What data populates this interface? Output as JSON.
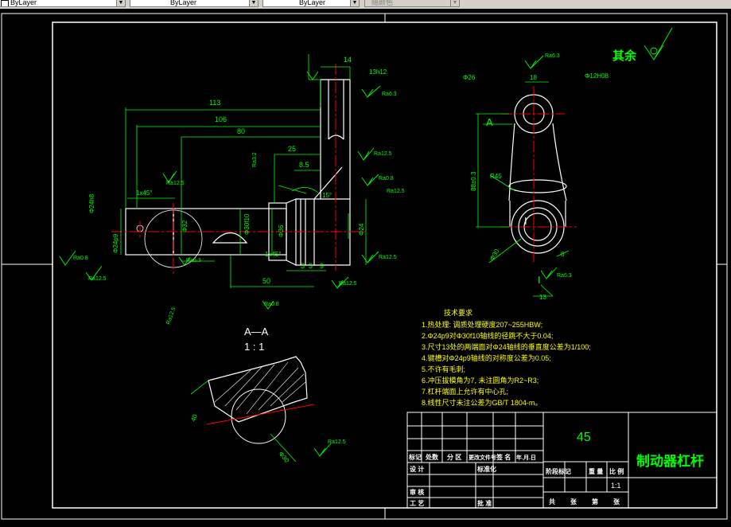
{
  "toolbar": {
    "layer_combo": "ByLayer",
    "linetype_combo": "ByLayer",
    "lineweight_combo": "ByLayer",
    "plotstyle_combo": "随颜色"
  },
  "colors": {
    "background": "#000000",
    "outline": "#ffffff",
    "dimension": "#00ff00",
    "centerline": "#ff0000",
    "note_text": "#ffff00"
  },
  "drawing": {
    "roughness_other": "其余",
    "section_label": "A—A",
    "section_scale": "1 : 1",
    "view_marker_a": "A",
    "view_marker_i": "I",
    "dims": {
      "d113": "113",
      "d106": "106",
      "d80": "80",
      "d25": "25",
      "d8_5": "8.5",
      "d14": "14",
      "d13h12": "13h12",
      "d50": "50",
      "d3a": "3",
      "d3b": "3",
      "d9": "9",
      "d1x45a": "1x45°",
      "d1x45b": "1x45°",
      "d15": "15°",
      "d18": "18",
      "d26": "Φ26",
      "d12h08": "Φ12H08",
      "d88": "88±0.3",
      "r45": "R45",
      "d6": "6",
      "d13": "13",
      "d30": "Φ30",
      "phi24a": "Φ24h8",
      "phi24b": "Φ24p9",
      "phi32": "Φ32",
      "phi30f": "Φ30f10",
      "phi36": "Φ36",
      "phi24c": "Φ24",
      "sec40": "40",
      "sec30": "Φ30",
      "ra63a": "Ra6.3",
      "ra63b": "Ra6.3",
      "ra63c": "Ra6.3",
      "ra63d": "Ra6.3",
      "ra125a": "Ra12.5",
      "ra125b": "Ra12.5",
      "ra125c": "Ra12.5",
      "ra125d": "Ra12.5",
      "ra125e": "Ra12.5",
      "ra125f": "Ra12.5",
      "ra125g": "Ra12.5",
      "ra125h": "Ra12.5",
      "ra08a": "Ra0.8",
      "ra08b": "Ra0.8",
      "ra08c": "Ra0.8",
      "ra32": "Ra3.2"
    }
  },
  "tech_notes": {
    "title": "技术要求",
    "lines": [
      "1.热处理: 调质处理硬度207~255HBW;",
      "2.Φ24p9对Φ30f10轴线的径跳不大于0.04;",
      "3.尺寸13处的两端面对Φ24轴线的垂直度公差为1/100;",
      "4.键槽对Φ24p9轴线的对称度公差为0.05;",
      "5.不许有毛刺;",
      "6.冲压拔模角为7, 未注圆角为R2~R3;",
      "7.杠杆端面上允许有中心孔;",
      "8.线性尺寸未注公差为GB/T 1804-m。"
    ]
  },
  "title_block": {
    "material": "45",
    "part_name": "制动器杠杆",
    "scale_value": "1:1",
    "h_marking": "标记",
    "h_count": "处数",
    "h_zone": "分 区",
    "h_docno": "更改文件号",
    "h_sign": "签 名",
    "h_date": "年.月.日",
    "h_design": "设 计",
    "h_std": "标准化",
    "h_stage": "阶段标记",
    "h_weight": "重 量",
    "h_ratio": "比 例",
    "h_review": "审 核",
    "h_process": "工 艺",
    "h_approve": "批 准",
    "h_total": "共",
    "h_sheets": "张",
    "h_page": "第",
    "h_sheet2": "张"
  }
}
